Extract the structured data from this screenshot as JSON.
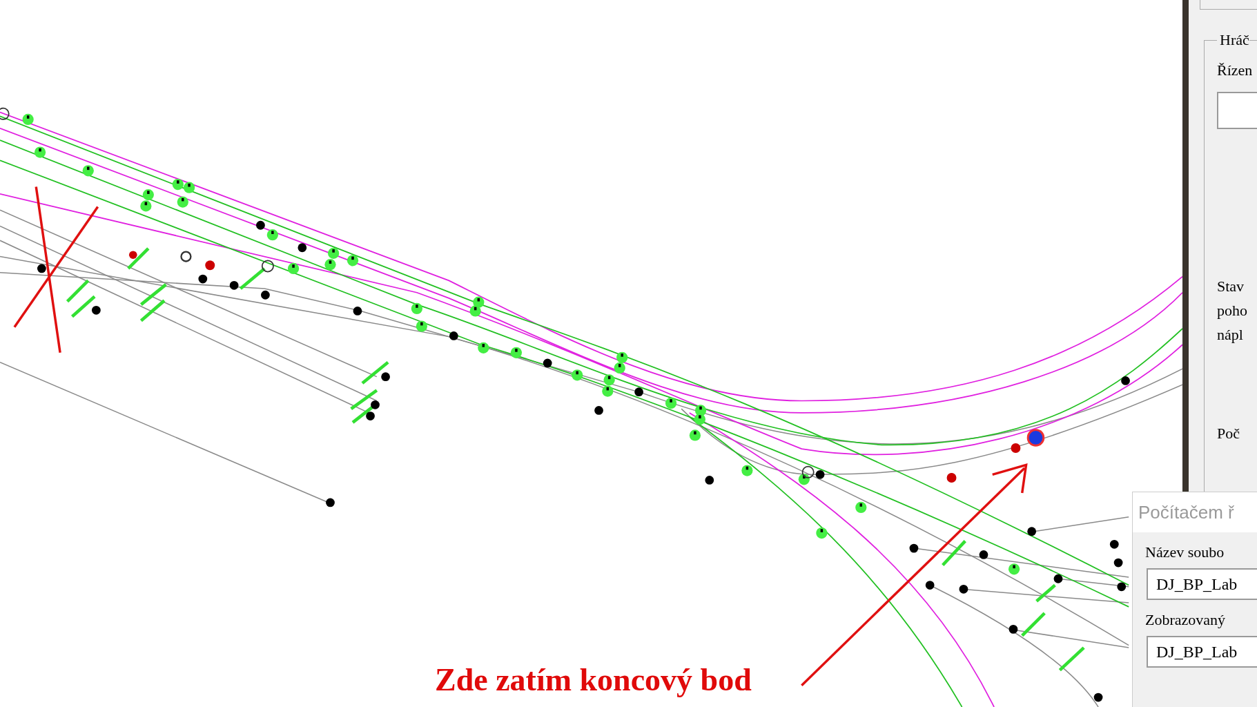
{
  "annotation": {
    "text": "Zde zatím koncový bod"
  },
  "side_panel": {
    "group_title": "Hráč",
    "label_1": "Řízen",
    "status_lines": [
      "Stav",
      "poho",
      "nápl"
    ],
    "label_2": "Poč"
  },
  "dialog": {
    "title": "Počítačem ř",
    "fields": [
      {
        "label": "Název soubo",
        "value": "DJ_BP_Lab"
      },
      {
        "label": "Zobrazovaný",
        "value": "DJ_BP_Lab"
      }
    ]
  }
}
